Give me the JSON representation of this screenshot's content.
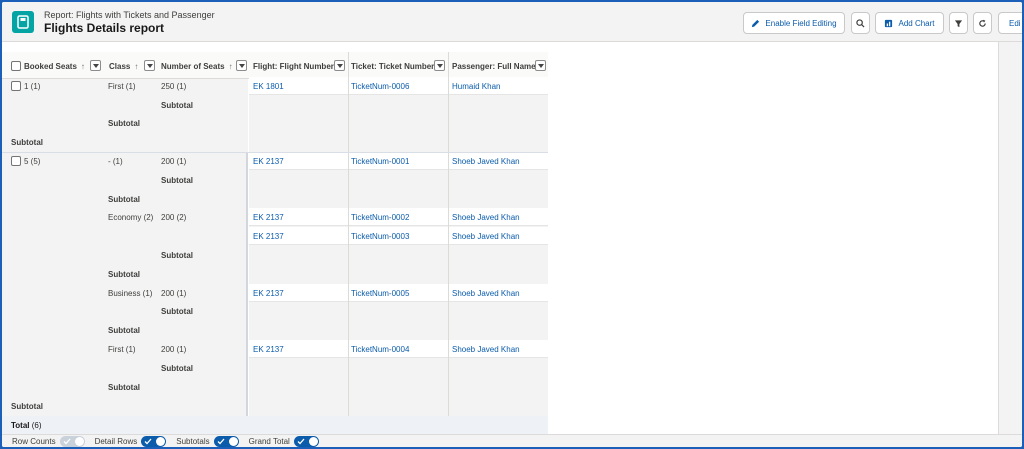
{
  "header": {
    "subtitle": "Report: Flights with Tickets and Passenger",
    "title": "Flights Details report"
  },
  "toolbar": {
    "enable_field_editing": "Enable Field Editing",
    "add_chart": "Add Chart",
    "edit": "Edi"
  },
  "columns": {
    "booked_seats": "Booked Seats",
    "class": "Class",
    "number_of_seats": "Number of Seats",
    "flight_number": "Flight: Flight Number",
    "ticket_number": "Ticket: Ticket Number",
    "passenger": "Passenger: Full Name"
  },
  "labels": {
    "subtotal": "Subtotal",
    "total": "Total",
    "total_count": "(6)"
  },
  "groups": [
    {
      "booked": "1 (1)",
      "class": "First (1)",
      "seats": "250 (1)",
      "flight": "EK 1801",
      "ticket": "TicketNum-0006",
      "passenger": "Humaid Khan"
    },
    {
      "booked": "5 (5)",
      "class": "- (1)",
      "seats": "200 (1)",
      "flight": "EK 2137",
      "ticket": "TicketNum-0001",
      "passenger": "Shoeb Javed Khan"
    },
    {
      "class": "Economy (2)",
      "seats": "200 (2)",
      "flight": "EK 2137",
      "ticket": "TicketNum-0002",
      "passenger": "Shoeb Javed Khan"
    },
    {
      "flight": "EK 2137",
      "ticket": "TicketNum-0003",
      "passenger": "Shoeb Javed Khan"
    },
    {
      "class": "Business (1)",
      "seats": "200 (1)",
      "flight": "EK 2137",
      "ticket": "TicketNum-0005",
      "passenger": "Shoeb Javed Khan"
    },
    {
      "class": "First (1)",
      "seats": "200 (1)",
      "flight": "EK 2137",
      "ticket": "TicketNum-0004",
      "passenger": "Shoeb Javed Khan"
    }
  ],
  "footer": {
    "row_counts": "Row Counts",
    "detail_rows": "Detail Rows",
    "subtotals": "Subtotals",
    "grand_total": "Grand Total"
  },
  "colors": {
    "accent": "#0b5cab",
    "app_icon": "#04a4a5",
    "window_border": "#1b5fb8"
  }
}
